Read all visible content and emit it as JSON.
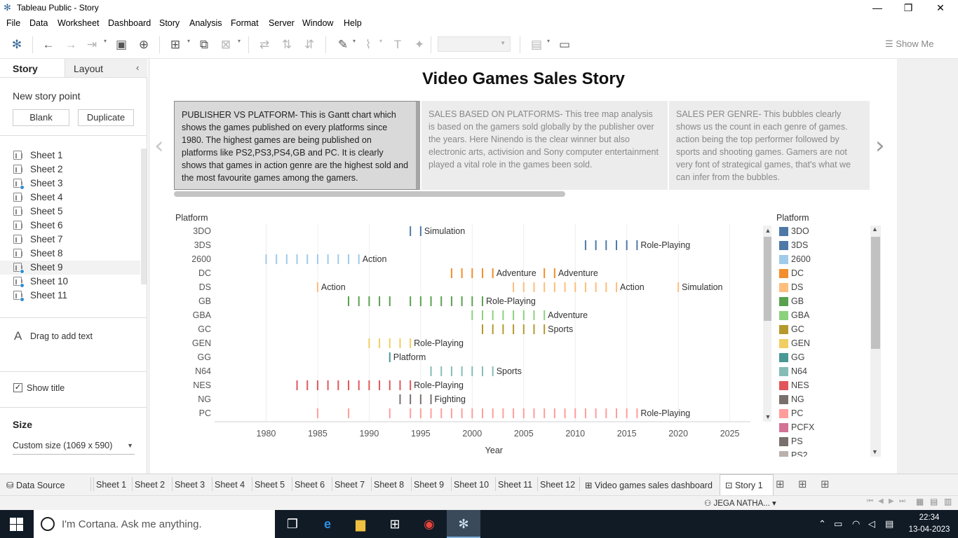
{
  "window": {
    "title": "Tableau Public - Story",
    "minimize": "—",
    "restore": "❐",
    "close": "✕"
  },
  "menu": [
    "File",
    "Data",
    "Worksheet",
    "Dashboard",
    "Story",
    "Analysis",
    "Format",
    "Server",
    "Window",
    "Help"
  ],
  "toolbar": {
    "show_me": "Show Me"
  },
  "left_panel": {
    "tabs": [
      "Story",
      "Layout"
    ],
    "new_story_point": "New story point",
    "blank_button": "Blank",
    "duplicate_button": "Duplicate",
    "sheets": [
      {
        "label": "Sheet 1",
        "linked": false
      },
      {
        "label": "Sheet 2",
        "linked": false
      },
      {
        "label": "Sheet 3",
        "linked": true
      },
      {
        "label": "Sheet 4",
        "linked": false
      },
      {
        "label": "Sheet 5",
        "linked": false
      },
      {
        "label": "Sheet 6",
        "linked": false
      },
      {
        "label": "Sheet 7",
        "linked": false
      },
      {
        "label": "Sheet 8",
        "linked": false
      },
      {
        "label": "Sheet 9",
        "linked": true
      },
      {
        "label": "Sheet 10",
        "linked": true
      },
      {
        "label": "Sheet 11",
        "linked": true
      }
    ],
    "drag_text": "Drag to add text",
    "show_title": "Show title",
    "show_title_checked": "✓",
    "size_label": "Size",
    "size_value": "Custom size (1069 x 590)"
  },
  "story": {
    "title": "Video Games Sales Story",
    "points": [
      "PUBLISHER VS PLATFORM- This is Gantt chart which shows the games published on every platforms since 1980.  The highest games are being published on platforms like PS2,PS3,PS4,GB and PC.  It is clearly shows that games in action genre are the highest sold and the most favourite games among the gamers.",
      "SALES BASED ON PLATFORMS-  This tree map analysis is based on the gamers sold globally by the publisher over the years. Here Ninendo is the clear winner but also electronic arts, activision and Sony computer entertainment played a vital role in the games been sold.",
      "SALES PER GENRE- This bubbles clearly shows us the count in each genre of games. action being the top performer followed by sports and shooting games. Gamers are not very font of strategical games, that's what we can infer from the bubbles."
    ]
  },
  "chart_data": {
    "type": "gantt",
    "row_header": "Platform",
    "xlabel": "Year",
    "xlim": [
      1975,
      2027
    ],
    "xticks": [
      1980,
      1985,
      1990,
      1995,
      2000,
      2005,
      2010,
      2015,
      2020,
      2025
    ],
    "rows": [
      {
        "platform": "3DO",
        "color": "#4e79a7",
        "years": [
          1994,
          1995
        ],
        "labels": [
          {
            "year": 1995,
            "text": "Simulation"
          }
        ]
      },
      {
        "platform": "3DS",
        "color": "#4e79a7",
        "years": [
          2011,
          2012,
          2013,
          2014,
          2015,
          2016
        ],
        "labels": [
          {
            "year": 2016,
            "text": "Role-Playing"
          }
        ]
      },
      {
        "platform": "2600",
        "color": "#a0cbe8",
        "years": [
          1980,
          1981,
          1982,
          1983,
          1984,
          1985,
          1986,
          1987,
          1988,
          1989
        ],
        "labels": [
          {
            "year": 1989,
            "text": "Action"
          }
        ]
      },
      {
        "platform": "DC",
        "color": "#f28e2b",
        "years": [
          1998,
          1999,
          2000,
          2001,
          2002,
          2007,
          2008
        ],
        "labels": [
          {
            "year": 2002,
            "text": "Adventure"
          },
          {
            "year": 2008,
            "text": "Adventure"
          }
        ]
      },
      {
        "platform": "DS",
        "color": "#ffbe7d",
        "years": [
          1985,
          2004,
          2005,
          2006,
          2007,
          2008,
          2009,
          2010,
          2011,
          2012,
          2013,
          2014,
          2020
        ],
        "labels": [
          {
            "year": 1985,
            "text": "Action"
          },
          {
            "year": 2014,
            "text": "Action"
          },
          {
            "year": 2020,
            "text": "Simulation"
          }
        ]
      },
      {
        "platform": "GB",
        "color": "#59a14f",
        "years": [
          1988,
          1989,
          1990,
          1991,
          1992,
          1994,
          1995,
          1996,
          1997,
          1998,
          1999,
          2000,
          2001
        ],
        "labels": [
          {
            "year": 2001,
            "text": "Role-Playing"
          }
        ]
      },
      {
        "platform": "GBA",
        "color": "#8cd17d",
        "years": [
          2000,
          2001,
          2002,
          2003,
          2004,
          2005,
          2006,
          2007
        ],
        "labels": [
          {
            "year": 2007,
            "text": "Adventure"
          }
        ]
      },
      {
        "platform": "GC",
        "color": "#b6992d",
        "years": [
          2001,
          2002,
          2003,
          2004,
          2005,
          2006,
          2007
        ],
        "labels": [
          {
            "year": 2007,
            "text": "Sports"
          }
        ]
      },
      {
        "platform": "GEN",
        "color": "#f1ce63",
        "years": [
          1990,
          1991,
          1992,
          1993,
          1994
        ],
        "labels": [
          {
            "year": 1994,
            "text": "Role-Playing"
          }
        ]
      },
      {
        "platform": "GG",
        "color": "#499894",
        "years": [
          1992
        ],
        "labels": [
          {
            "year": 1992,
            "text": "Platform"
          }
        ]
      },
      {
        "platform": "N64",
        "color": "#86bcb6",
        "years": [
          1996,
          1997,
          1998,
          1999,
          2000,
          2001,
          2002
        ],
        "labels": [
          {
            "year": 2002,
            "text": "Sports"
          }
        ]
      },
      {
        "platform": "NES",
        "color": "#e15759",
        "years": [
          1983,
          1984,
          1985,
          1986,
          1987,
          1988,
          1989,
          1990,
          1991,
          1992,
          1993,
          1994
        ],
        "labels": [
          {
            "year": 1994,
            "text": "Role-Playing"
          }
        ]
      },
      {
        "platform": "NG",
        "color": "#79706e",
        "years": [
          1993,
          1994,
          1995,
          1996
        ],
        "labels": [
          {
            "year": 1996,
            "text": "Fighting"
          }
        ]
      },
      {
        "platform": "PC",
        "color": "#ff9d9a",
        "years": [
          1985,
          1988,
          1992,
          1994,
          1995,
          1996,
          1997,
          1998,
          1999,
          2000,
          2001,
          2002,
          2003,
          2004,
          2005,
          2006,
          2007,
          2008,
          2009,
          2010,
          2011,
          2012,
          2013,
          2014,
          2015,
          2016
        ],
        "labels": [
          {
            "year": 2016,
            "text": "Role-Playing"
          }
        ]
      }
    ]
  },
  "legend": {
    "title": "Platform",
    "items": [
      {
        "label": "3DO",
        "color": "#4e79a7"
      },
      {
        "label": "3DS",
        "color": "#4e79a7"
      },
      {
        "label": "2600",
        "color": "#a0cbe8"
      },
      {
        "label": "DC",
        "color": "#f28e2b"
      },
      {
        "label": "DS",
        "color": "#ffbe7d"
      },
      {
        "label": "GB",
        "color": "#59a14f"
      },
      {
        "label": "GBA",
        "color": "#8cd17d"
      },
      {
        "label": "GC",
        "color": "#b6992d"
      },
      {
        "label": "GEN",
        "color": "#f1ce63"
      },
      {
        "label": "GG",
        "color": "#499894"
      },
      {
        "label": "N64",
        "color": "#86bcb6"
      },
      {
        "label": "NES",
        "color": "#e15759"
      },
      {
        "label": "NG",
        "color": "#79706e"
      },
      {
        "label": "PC",
        "color": "#ff9d9a"
      },
      {
        "label": "PCFX",
        "color": "#d37295"
      },
      {
        "label": "PS",
        "color": "#79706e"
      },
      {
        "label": "PS2",
        "color": "#bab0ac"
      }
    ]
  },
  "bottom_tabs": {
    "data_source": "Data Source",
    "sheets": [
      "Sheet 1",
      "Sheet 2",
      "Sheet 3",
      "Sheet 4",
      "Sheet 5",
      "Sheet 6",
      "Sheet 7",
      "Sheet 8",
      "Sheet 9",
      "Sheet 10",
      "Sheet 11",
      "Sheet 12"
    ],
    "dashboard": "Video games sales dashboard",
    "story": "Story 1"
  },
  "status": {
    "user": "JEGA NATHA..."
  },
  "taskbar": {
    "cortana_placeholder": "I'm Cortana. Ask me anything.",
    "time": "22:34",
    "date": "13-04-2023"
  }
}
